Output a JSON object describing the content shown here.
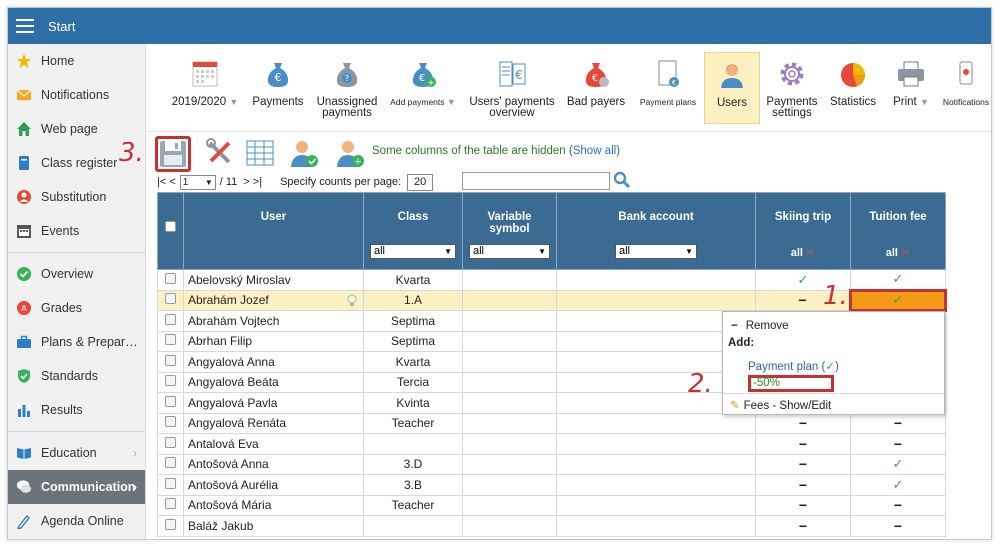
{
  "topbar": {
    "title": "Start"
  },
  "sidebar": {
    "items": [
      {
        "label": "Home",
        "icon": "star-icon"
      },
      {
        "label": "Notifications",
        "icon": "envelope-icon"
      },
      {
        "label": "Web page",
        "icon": "house-icon"
      },
      {
        "label": "Class register",
        "icon": "book-icon"
      },
      {
        "label": "Substitution",
        "icon": "person-icon"
      },
      {
        "label": "Events",
        "icon": "calendar-icon"
      },
      {
        "label": "Overview",
        "icon": "check-circle-icon"
      },
      {
        "label": "Grades",
        "icon": "grades-icon"
      },
      {
        "label": "Plans & Prepar…",
        "icon": "briefcase-icon"
      },
      {
        "label": "Standards",
        "icon": "shield-icon"
      },
      {
        "label": "Results",
        "icon": "bar-chart-icon"
      },
      {
        "label": "Education",
        "icon": "open-book-icon"
      },
      {
        "label": "Communication",
        "icon": "chat-icon"
      },
      {
        "label": "Agenda Online",
        "icon": "pen-icon"
      }
    ]
  },
  "toolbar": {
    "year": "2019/2020",
    "payments": "Payments",
    "unassigned_1": "Unassigned",
    "unassigned_2": "payments",
    "add_payments": "Add payments",
    "users_payments_1": "Users' payments",
    "users_payments_2": "overview",
    "bad_payers": "Bad payers",
    "payment_plans": "Payment plans",
    "users": "Users",
    "payments_settings_1": "Payments",
    "payments_settings_2": "settings",
    "statistics": "Statistics",
    "print": "Print",
    "notifications": "Notifications"
  },
  "actions": {
    "hidden_note": "Some columns of the table are hidden",
    "show_all": "Show all"
  },
  "pager": {
    "first": "|< <",
    "page": "1",
    "of": "/ 11",
    "last": "> >|",
    "counts_label": "Specify counts per page:",
    "counts_value": "20"
  },
  "table": {
    "headers": {
      "user": "User",
      "class": "Class",
      "variable_symbol_1": "Variable",
      "variable_symbol_2": "symbol",
      "bank_account": "Bank account",
      "skiing_trip": "Skiing trip",
      "tuition_fee": "Tuition fee"
    },
    "filters": {
      "class": "all",
      "variable": "all",
      "bank": "all",
      "skiing": "all",
      "tuition": "all"
    },
    "rows": [
      {
        "name": "Abelovský Miroslav",
        "class": "Kvarta",
        "ski": "✓",
        "fee": "✓"
      },
      {
        "name": "Abrahám Jozef",
        "class": "1.A",
        "ski": "−",
        "fee": "✓"
      },
      {
        "name": "Abrahám Vojtech",
        "class": "Septima",
        "ski": "",
        "fee": ""
      },
      {
        "name": "Abrhan Filip",
        "class": "Septima",
        "ski": "",
        "fee": ""
      },
      {
        "name": "Angyalová Anna",
        "class": "Kvarta",
        "ski": "",
        "fee": ""
      },
      {
        "name": "Angyalová Beáta",
        "class": "Tercia",
        "ski": "",
        "fee": ""
      },
      {
        "name": "Angyalová Pavla",
        "class": "Kvinta",
        "ski": "",
        "fee": ""
      },
      {
        "name": "Angyalová Renáta",
        "class": "Teacher",
        "ski": "−",
        "fee": "−"
      },
      {
        "name": "Antalová Eva",
        "class": "",
        "ski": "−",
        "fee": "−"
      },
      {
        "name": "Antošová Anna",
        "class": "3.D",
        "ski": "−",
        "fee": "✓"
      },
      {
        "name": "Antošová Aurélia",
        "class": "3.B",
        "ski": "−",
        "fee": "✓"
      },
      {
        "name": "Antošová Mária",
        "class": "Teacher",
        "ski": "−",
        "fee": "−"
      },
      {
        "name": "Baláž Jakub",
        "class": "",
        "ski": "−",
        "fee": "−"
      }
    ]
  },
  "popup": {
    "remove": "Remove",
    "add": "Add:",
    "payment_plan": "Payment plan (",
    "payment_plan_check": "✓",
    "payment_plan_close": ")",
    "discount": "-50%",
    "fees": "Fees - Show/Edit"
  },
  "annotations": {
    "one": "1.",
    "two": "2.",
    "three": "3."
  }
}
